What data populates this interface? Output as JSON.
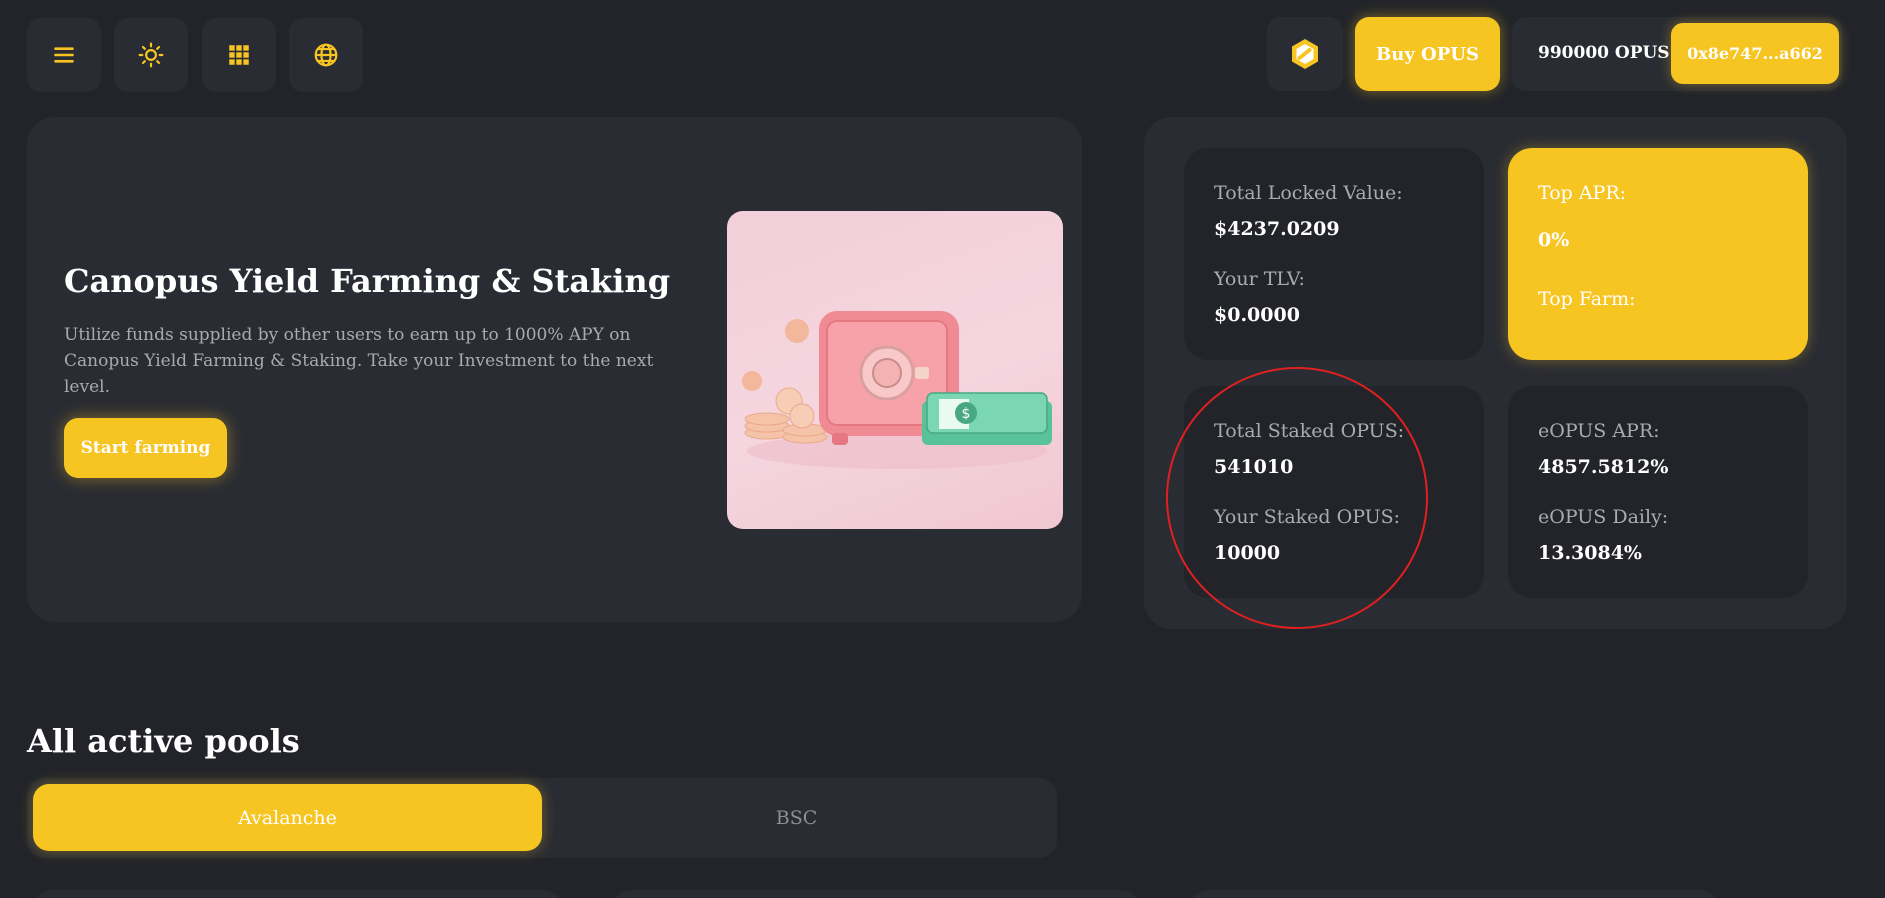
{
  "header": {
    "buy_label": "Buy OPUS",
    "balance": "990000 OPUS",
    "address": "0x8e747...a662"
  },
  "hero": {
    "title": "Canopus Yield Farming & Staking",
    "description": "Utilize funds supplied by other users to earn up to 1000% APY on Canopus Yield Farming & Staking. Take your Investment to the next level.",
    "cta_label": "Start farming"
  },
  "stats": {
    "total_locked_label": "Total Locked Value:",
    "total_locked_value": "$4237.0209",
    "your_tlv_label": "Your TLV:",
    "your_tlv_value": "$0.0000",
    "top_apr_label": "Top APR:",
    "top_apr_value": "0%",
    "top_farm_label": "Top Farm:",
    "total_staked_label": "Total Staked OPUS:",
    "total_staked_value": "541010",
    "your_staked_label": "Your Staked OPUS:",
    "your_staked_value": "10000",
    "eopus_apr_label": "eOPUS APR:",
    "eopus_apr_value": "4857.5812%",
    "eopus_daily_label": "eOPUS Daily:",
    "eopus_daily_value": "13.3084%"
  },
  "pools": {
    "title": "All active pools",
    "tabs": [
      {
        "label": "Avalanche"
      },
      {
        "label": "BSC"
      }
    ]
  },
  "colors": {
    "background": "#22242a",
    "panel": "#2a2c33",
    "accent": "#f6c522",
    "annotation": "#e02020"
  }
}
